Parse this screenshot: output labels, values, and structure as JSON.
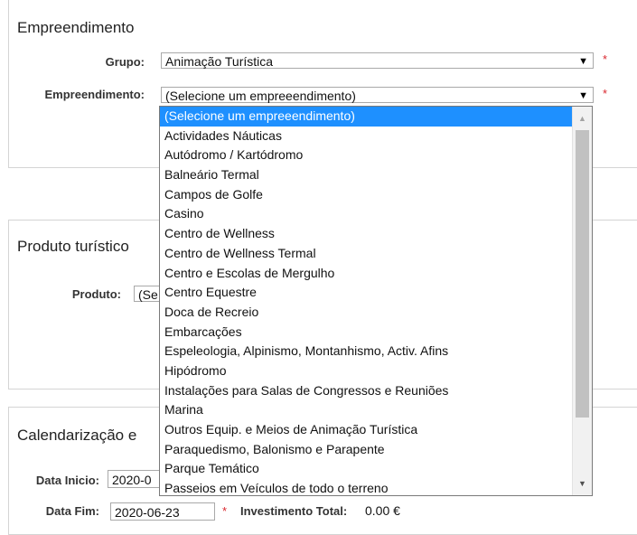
{
  "section_empreendimento": {
    "legend": "Empreendimento",
    "grupo_label": "Grupo:",
    "grupo_value": "Animação Turística",
    "empreendimento_label": "Empreendimento:",
    "empreendimento_value": "(Selecione um empreeendimento)",
    "required_mark": "*"
  },
  "dropdown": {
    "options": [
      "(Selecione um empreeendimento)",
      "Actividades Náuticas",
      "Autódromo / Kartódromo",
      "Balneário Termal",
      "Campos de Golfe",
      "Casino",
      "Centro de Wellness",
      "Centro de Wellness Termal",
      "Centro e Escolas de Mergulho",
      "Centro Equestre",
      "Doca de Recreio",
      "Embarcações",
      "Espeleologia, Alpinismo, Montanhismo, Activ. Afins",
      "Hipódromo",
      "Instalações para Salas de Congressos e Reuniões",
      "Marina",
      "Outros Equip. e Meios de Animação Turística",
      "Paraquedismo, Balonismo e Parapente",
      "Parque Temático",
      "Passeios em Veículos de todo o terreno"
    ],
    "selected_index": 0,
    "scroll_up_icon": "▲",
    "scroll_down_icon": "▼"
  },
  "section_produto": {
    "legend": "Produto turístico",
    "produto_label": "Produto:",
    "produto_value_partial": "(Se"
  },
  "section_calendario": {
    "legend_partial": "Calendarização e",
    "data_inicio_label": "Data Inicio:",
    "data_inicio_value_partial": "2020-0",
    "data_fim_label": "Data Fim:",
    "data_fim_value": "2020-06-23",
    "required_mark": "*",
    "investimento_label": "Investimento Total:",
    "investimento_value": "0.00 €"
  },
  "colors": {
    "selection": "#1e90ff",
    "required": "#d9272e",
    "border": "#d4d4d4"
  }
}
